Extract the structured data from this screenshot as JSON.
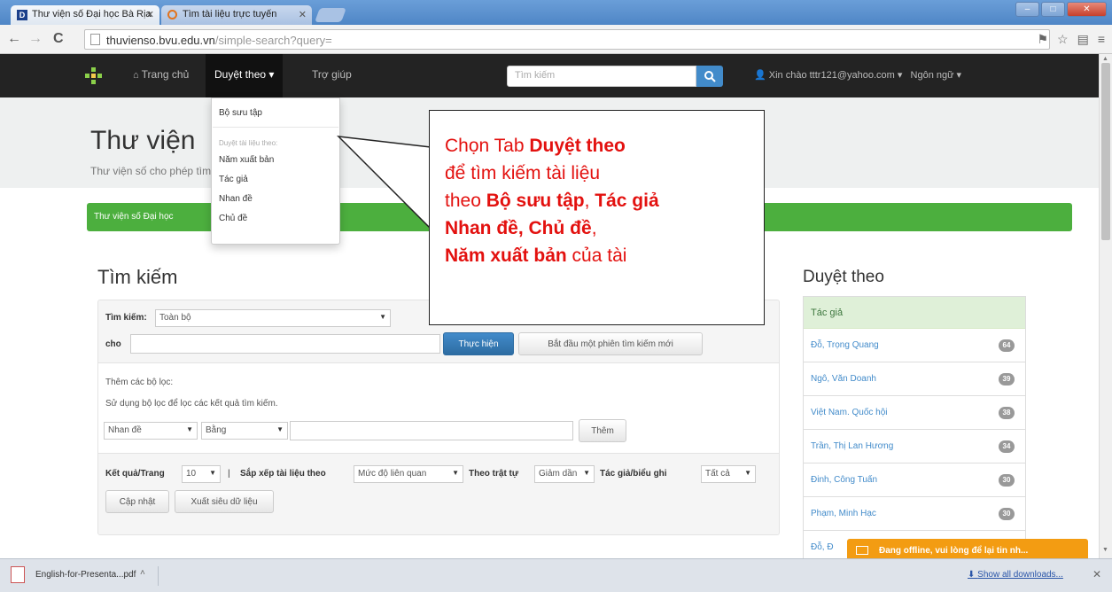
{
  "browser": {
    "tabs": [
      {
        "title": "Thư viện số Đại học Bà Rịa"
      },
      {
        "title": "Tìm tài liệu trực tuyến"
      }
    ],
    "url_host": "thuvienso.bvu.edu.vn",
    "url_path": "/simple-search?query="
  },
  "navbar": {
    "home": "Trang chủ",
    "browse": "Duyệt theo",
    "help": "Trợ giúp",
    "search_placeholder": "Tìm kiếm",
    "user": "Xin chào tttr121@yahoo.com",
    "language": "Ngôn ngữ"
  },
  "dropdown": {
    "items": [
      "Bộ sưu tập",
      "Duyệt tài liệu theo:",
      "Năm xuất bản",
      "Tác giả",
      "Nhan đề",
      "Chủ đề"
    ]
  },
  "jumbotron": {
    "title": "Thư viện",
    "subtitle": "Thư viện số cho phép tìm kiếm tài liệu"
  },
  "banner": "Thư viện số Đại học",
  "callout": {
    "t1": "Chọn Tab ",
    "b1": "Duyệt theo",
    "t2": "để tìm kiếm tài liệu",
    "t3": "theo ",
    "b2": "Bộ sưu tập",
    "t4": ", ",
    "b3": "Tác giả",
    "t5": ", ",
    "b4": "Nhan đề, Chủ đề",
    "t6": ",",
    "b5": "Năm xuất bản",
    "t7": " của tài"
  },
  "search": {
    "heading": "Tìm kiếm",
    "scope_label": "Tìm kiếm:",
    "scope_value": "Toàn bộ",
    "for_label": "cho",
    "go_button": "Thực hiện",
    "new_search_button": "Bắt đầu một phiên tìm kiếm mới",
    "filters_title": "Thêm các bộ lọc:",
    "filters_help": "Sử dụng bộ lọc để lọc các kết quả tìm kiếm.",
    "filter_field": "Nhan đề",
    "filter_op": "Bằng",
    "add_button": "Thêm",
    "results_label": "Kết quả/Trang",
    "results_value": "10",
    "sort_label": "Sắp xếp tài liệu theo",
    "sort_value": "Mức độ liên quan",
    "order_label": "Theo trật tự",
    "order_value": "Giảm dần",
    "author_label": "Tác giả/biểu ghi",
    "author_value": "Tất cả",
    "update_button": "Cập nhật",
    "export_button": "Xuất siêu dữ liệu"
  },
  "sidebar": {
    "heading": "Duyệt theo",
    "panel_title": "Tác giả",
    "items": [
      {
        "name": "Đỗ, Trọng Quang",
        "count": "64"
      },
      {
        "name": "Ngô, Văn Doanh",
        "count": "39"
      },
      {
        "name": "Việt Nam. Quốc hội",
        "count": "38"
      },
      {
        "name": "Trần, Thị Lan Hương",
        "count": "34"
      },
      {
        "name": "Đinh, Công Tuấn",
        "count": "30"
      },
      {
        "name": "Phạm, Minh Hạc",
        "count": "30"
      },
      {
        "name": "Đỗ, Đ",
        "count": ""
      }
    ]
  },
  "chat": "Đang offline, vui lòng để lại tin nh...",
  "downloads": {
    "file": "English-for-Presenta...pdf",
    "show_all": "Show all downloads..."
  }
}
